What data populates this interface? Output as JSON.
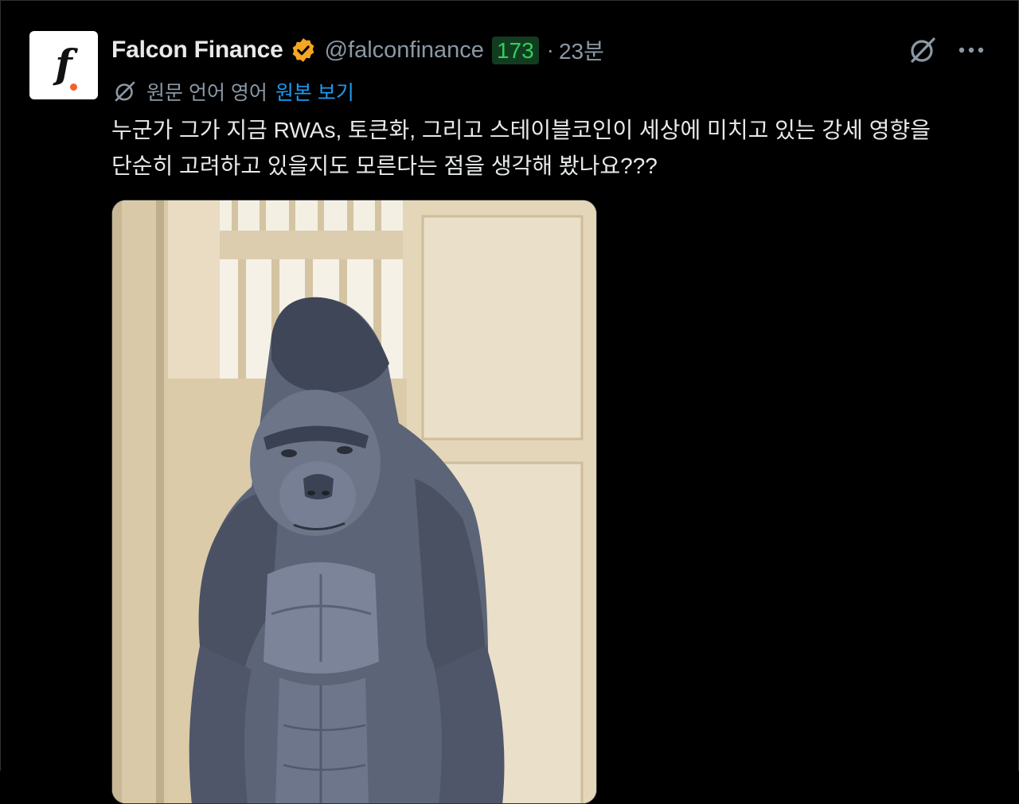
{
  "tweet": {
    "author_name": "Falcon Finance",
    "handle": "@falconfinance",
    "score": "173",
    "separator": "·",
    "time": "23분",
    "translation": {
      "label": "원문 언어 영어",
      "link": "원본 보기"
    },
    "text_line1": "누군가 그가 지금 RWAs, 토큰화, 그리고 스테이블코인이 세상에 미치고 있는 강세 영향을",
    "text_line2": "단순히 고려하고 있을지도 모른다는 점을 생각해 봤나요???",
    "avatar_letter": "f.",
    "media_description": "gorilla image"
  },
  "icons": {
    "verified": "verified-badge-icon",
    "translate": "translate-icon",
    "grok": "grok-icon",
    "more": "more-icon"
  },
  "colors": {
    "background": "#000000",
    "text": "#e7e9ea",
    "secondary": "#8b98a5",
    "link": "#1d9bf0",
    "score_text": "#2fd05a",
    "verified": "#f5a623",
    "avatar_dot": "#f0622f"
  }
}
